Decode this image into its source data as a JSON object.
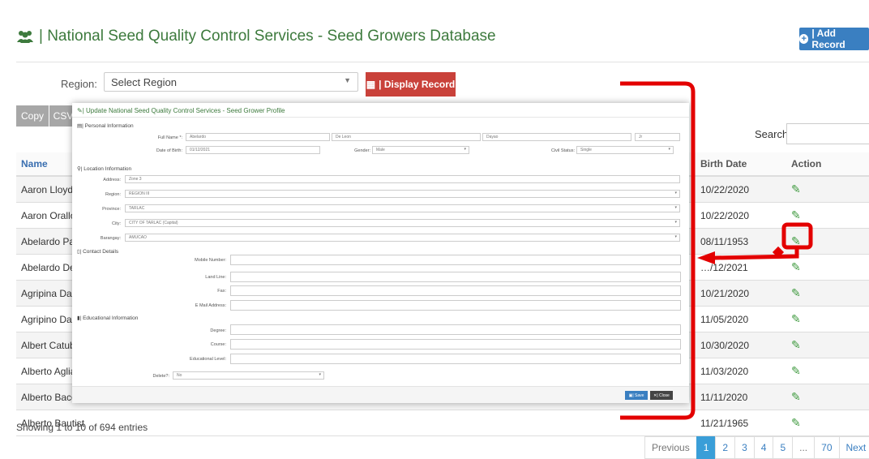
{
  "page": {
    "title": "| National Seed Quality Control Services - Seed Growers Database",
    "add_record": "| Add Record"
  },
  "filter": {
    "region_label": "Region:",
    "region_value": "Select Region",
    "display_button": "| Display Record"
  },
  "toolbar": {
    "copy": "Copy",
    "csv": "CSV"
  },
  "search": {
    "label": "Search:"
  },
  "table": {
    "headers": [
      "Name",
      "Birth Date",
      "Action"
    ],
    "rows": [
      {
        "name": "Aaron Lloyd Ja",
        "birth": "10/22/2020"
      },
      {
        "name": "Aaron Orallo M",
        "birth": "10/22/2020"
      },
      {
        "name": "Abelardo Padil",
        "birth": "08/11/1953"
      },
      {
        "name": "Abelardo De L",
        "birth": "…/12/2021"
      },
      {
        "name": "Agripina Dama",
        "birth": "10/21/2020"
      },
      {
        "name": "Agripino Daya",
        "birth": "11/05/2020"
      },
      {
        "name": "Albert Catubay",
        "birth": "10/30/2020"
      },
      {
        "name": "Alberto Agliam",
        "birth": "11/03/2020"
      },
      {
        "name": "Alberto Bacob",
        "birth": "11/11/2020"
      },
      {
        "name": "Alberto Bautist",
        "birth": "11/21/1965"
      }
    ]
  },
  "footer": {
    "showing": "Showing 1 to 10 of 694 entries",
    "pager": [
      "Previous",
      "1",
      "2",
      "3",
      "4",
      "5",
      "...",
      "70",
      "Next"
    ]
  },
  "modal": {
    "title": "| Update National Seed Quality Control Services - Seed Grower Profile",
    "personal_section": "| Personal Information",
    "full_name_label": "Full Name *:",
    "first_name": "Abelardo",
    "middle_name": "De Leon",
    "last_name": "Dayao",
    "suffix": "Jr",
    "dob_label": "Date of Birth:",
    "dob": "01/12/2021",
    "gender_label": "Gender:",
    "gender": "Male",
    "civil_label": "Civil Status:",
    "civil": "Single",
    "location_section": "| Location Information",
    "address_label": "Address:",
    "address": "Zone 3",
    "region_label": "Region:",
    "region": "REGION III",
    "province_label": "Province:",
    "province": "TARLAC",
    "city_label": "City:",
    "city": "CITY OF TARLAC (Capital)",
    "barangay_label": "Barangay:",
    "barangay": "AMUCAO",
    "contact_section": "| Contact Details",
    "mobile_label": "Mobile Number:",
    "landline_label": "Land Line:",
    "fax_label": "Fax:",
    "email_label": "E Mail Address:",
    "edu_section": "| Educational Information",
    "degree_label": "Degree:",
    "course_label": "Course:",
    "edlevel_label": "Educational Level:",
    "delete_label": "Delete?:",
    "delete_value": "No",
    "save": "| Save",
    "close": "| Close"
  },
  "colors": {
    "accent": "#3a7fc1",
    "danger": "#c9413a",
    "annotation": "#e30000",
    "title": "#3d7a3d"
  }
}
